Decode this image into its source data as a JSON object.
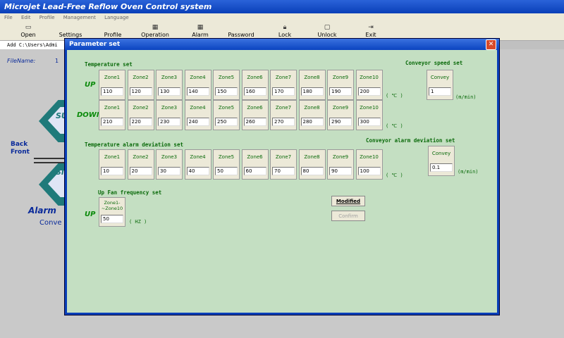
{
  "app": {
    "title": "Microjet Lead-Free Reflow Oven Control system",
    "menu": [
      "File",
      "Edit",
      "Profile",
      "Management",
      "Language"
    ],
    "toolbar": [
      "Open",
      "Settings",
      "Profile",
      "Operation",
      "Alarm",
      "Password",
      "Lock",
      "Unlock",
      "Exit"
    ],
    "address": "Add C:\\Users\\Admi",
    "filename_label": "FileName:",
    "filename_value": "1"
  },
  "background": {
    "back": "Back",
    "front": "Front",
    "alarm": "Alarm",
    "convey": "Conve",
    "hex1_text": "SU",
    "hex2_text": "SI"
  },
  "dialog": {
    "title": "Parameter set",
    "close": "✕",
    "temp_section": "Temperature set",
    "conveyor_speed_section": "Conveyor speed set",
    "up_label": "UP",
    "down_label": "DOWN",
    "zones": [
      "Zone1",
      "Zone2",
      "Zone3",
      "Zone4",
      "Zone5",
      "Zone6",
      "Zone7",
      "Zone8",
      "Zone9",
      "Zone10"
    ],
    "up_values": [
      "110",
      "120",
      "130",
      "140",
      "150",
      "160",
      "170",
      "180",
      "190",
      "200"
    ],
    "down_values": [
      "210",
      "220",
      "230",
      "240",
      "250",
      "260",
      "270",
      "280",
      "290",
      "300"
    ],
    "unit_c": "( ℃ )",
    "convey_label": "Convey",
    "convey_speed": "1",
    "unit_speed": "(m/min)",
    "alarm_section": "Temperature alarm deviation set",
    "alarm_values": [
      "10",
      "20",
      "30",
      "40",
      "50",
      "60",
      "70",
      "80",
      "90",
      "100"
    ],
    "conveyor_alarm_section": "Conveyor alarm deviation set",
    "convey_alarm_value": "0.1",
    "fan_section": "Up Fan frequency set",
    "fan_zone_label_1": "Zone1-",
    "fan_zone_label_2": "~Zone10",
    "fan_value": "50",
    "fan_unit": "( HZ )",
    "fan_up_label": "UP",
    "modified_btn": "Modified",
    "confirm_btn": "Confirm"
  }
}
